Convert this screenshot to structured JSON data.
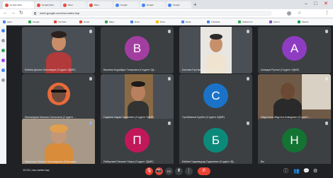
{
  "browser": {
    "tabs": [
      {
        "title": "Google Meet"
      },
      {
        "title": "Google Meet"
      },
      {
        "title": "Meet"
      },
      {
        "title": "Meet"
      },
      {
        "title": "Google"
      },
      {
        "title": "Google"
      },
      {
        "title": "Google"
      }
    ],
    "new_tab": "+",
    "window_controls": {
      "minimize": "–",
      "maximize": "□",
      "close": "✕"
    },
    "url": "meet.google.com/xsu-swbs-hsp",
    "nav": {
      "back": "←",
      "forward": "→",
      "reload": "↻"
    },
    "bookmarks": [
      "Apps",
      "Google",
      "YouTube",
      "Gmail",
      "Maps",
      "Docs",
      "Drive",
      "News",
      "Translate",
      "Classroom",
      "Forms",
      "Sheets"
    ]
  },
  "meeting": {
    "participants": [
      {
        "name": "Бабаев Даниил Магомедов (Студент ЗДМЕ)",
        "type": "video"
      },
      {
        "name": "Валиева Ксурайдат Тахировна (Студент ЗД...",
        "type": "avatar",
        "letter": "В",
        "color": "#a33ea1"
      },
      {
        "name": "Бахтаев Рустам (Студент ЗДМЕ)",
        "type": "video"
      },
      {
        "name": "Ахмедов Руслан (Студент ЗДМЕ)",
        "type": "avatar",
        "letter": "А",
        "color": "#8e3cc2"
      },
      {
        "name": "Магомедова Милана Салиховна (Студент ...",
        "type": "video"
      },
      {
        "name": "Гаджиев Хаджи Гаджиевич (Студент ЗДМЕ)",
        "type": "video"
      },
      {
        "name": "Сулейманов Курбан (Студент ЗДМЕ)",
        "type": "avatar",
        "letter": "С",
        "color": "#1a73c8"
      },
      {
        "name": "Абдуллаев Абдулла Ахмедович (Студент ...",
        "type": "video"
      },
      {
        "name": "Камилова Патимат Магомедовна (Преподав...",
        "type": "video",
        "highlight": true
      },
      {
        "name": "Пайзулаев Патимат Пахра (Студент ЗДМЕ)",
        "type": "avatar",
        "letter": "П",
        "color": "#c2185b"
      },
      {
        "name": "Бабаев Гаджимурад Гаджиевич (Студент ЗД...",
        "type": "avatar",
        "letter": "Б",
        "color": "#0b8a7a"
      },
      {
        "name": "Вы",
        "type": "avatar",
        "letter": "Н",
        "color": "#137333"
      }
    ],
    "controls": {
      "time": "10:20  |  xsu-swbs-hsp",
      "mic": "🎙",
      "camera": "📷",
      "captions": "CC",
      "present": "⬆",
      "more": "⋮",
      "end": "✆",
      "right": [
        "ⓘ",
        "👥",
        "💬",
        "⚙"
      ]
    }
  }
}
